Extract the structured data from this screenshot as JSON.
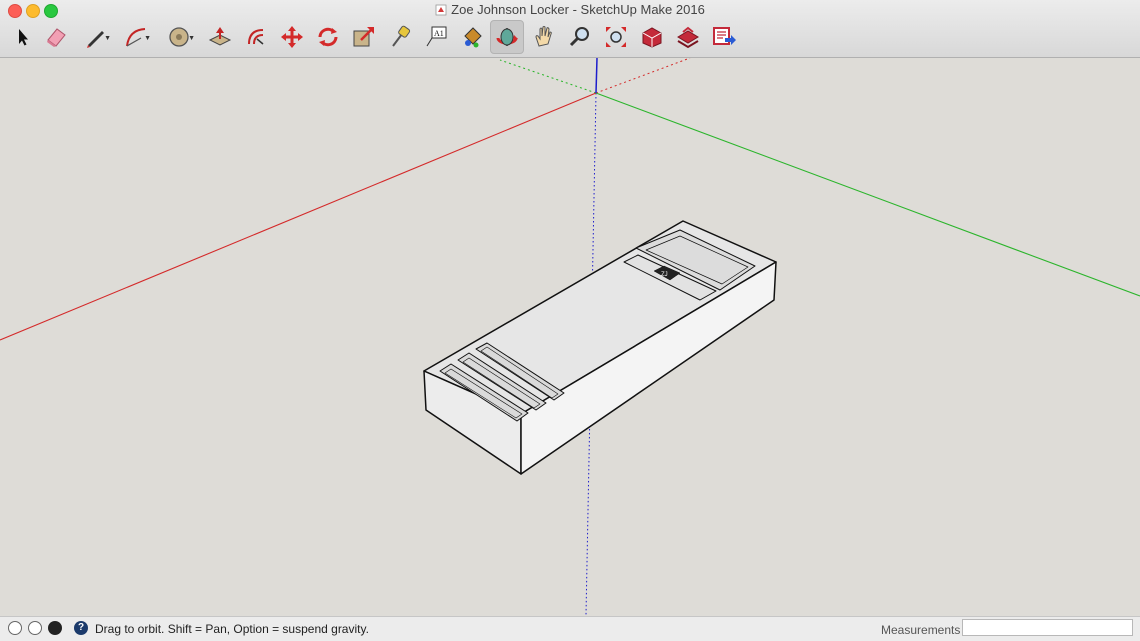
{
  "window": {
    "title": "Zoe Johnson Locker - SketchUp Make 2016"
  },
  "toolbar": {
    "tools": [
      {
        "name": "select-tool",
        "icon": "arrow-cursor-icon"
      },
      {
        "name": "eraser-tool",
        "icon": "eraser-icon"
      },
      {
        "name": "line-tool",
        "icon": "pencil-icon",
        "has_dropdown": true
      },
      {
        "name": "arc-tool",
        "icon": "arc-icon",
        "has_dropdown": true
      },
      {
        "name": "shapes-tool",
        "icon": "circle-icon",
        "has_dropdown": true
      },
      {
        "name": "push-pull-tool",
        "icon": "push-pull-icon"
      },
      {
        "name": "offset-tool",
        "icon": "offset-icon"
      },
      {
        "name": "move-tool",
        "icon": "move-arrows-icon"
      },
      {
        "name": "rotate-tool",
        "icon": "rotate-icon"
      },
      {
        "name": "scale-tool",
        "icon": "scale-icon"
      },
      {
        "name": "tape-measure-tool",
        "icon": "tape-measure-icon"
      },
      {
        "name": "text-tool",
        "icon": "text-label-icon"
      },
      {
        "name": "paint-bucket-tool",
        "icon": "paint-bucket-icon"
      },
      {
        "name": "orbit-tool",
        "icon": "orbit-icon",
        "active": true
      },
      {
        "name": "pan-tool",
        "icon": "hand-icon"
      },
      {
        "name": "zoom-tool",
        "icon": "magnifier-icon"
      },
      {
        "name": "zoom-extents-tool",
        "icon": "zoom-extents-icon"
      },
      {
        "name": "3d-warehouse-tool",
        "icon": "warehouse-icon"
      },
      {
        "name": "extension-warehouse-tool",
        "icon": "extension-warehouse-icon"
      },
      {
        "name": "send-to-layout-tool",
        "icon": "layout-icon"
      }
    ],
    "text_tool_glyph": "A1"
  },
  "colors": {
    "background": "#dedcd7",
    "red_axis": "#d42a2a",
    "green_axis": "#2cb52c",
    "blue_axis": "#1d1dcc",
    "active_tool": "#c9c9c9"
  },
  "statusbar": {
    "icons": [
      "geo-location-icon",
      "credits-icon",
      "user-account-icon",
      "help-icon"
    ],
    "help_glyph": "?",
    "message": "Drag to orbit. Shift = Pan, Option = suspend gravity.",
    "measurements_label": "Measurements",
    "measurements_value": ""
  },
  "model": {
    "name": "locker-box",
    "logo_glyph": "ZJ"
  }
}
